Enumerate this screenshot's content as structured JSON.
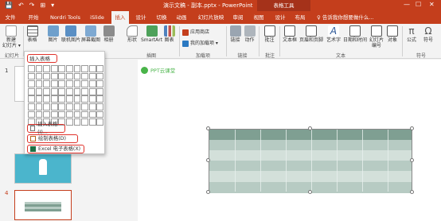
{
  "titlebar": {
    "quick_access": [
      "💾",
      "↶",
      "↷",
      "⊞",
      "▾"
    ],
    "doc_title": "演示文稿 - 副本.pptx  -  PowerPoint",
    "context_tool": "表格工具",
    "window_controls": [
      "—",
      "☐",
      "✕"
    ]
  },
  "tabs": [
    {
      "label": "文件"
    },
    {
      "label": "开始"
    },
    {
      "label": "Nordri Tools"
    },
    {
      "label": "iSlide"
    },
    {
      "label": "插入"
    },
    {
      "label": "设计"
    },
    {
      "label": "切换"
    },
    {
      "label": "动画"
    },
    {
      "label": "幻灯片放映"
    },
    {
      "label": "审阅"
    },
    {
      "label": "视图"
    },
    {
      "label": "设计"
    },
    {
      "label": "布局"
    }
  ],
  "active_tab": "插入",
  "tell_me": "♀ 告诉我你想要做什么...",
  "ribbon": {
    "buttons": {
      "new_slide": "新建\n幻灯片 ▾",
      "table": "表格",
      "picture": "图片",
      "online_picture": "联机图片",
      "screenshot": "屏幕截图",
      "album": "相册",
      "shapes": "形状",
      "smartart": "SmartArt",
      "chart": "图表",
      "link": "链接",
      "action": "动作",
      "comment": "批注",
      "textbox": "文本框",
      "header_footer": "页眉和页脚",
      "wordart": "艺术字",
      "datetime": "日期和时间",
      "slide_number": "幻灯片\n编号",
      "object": "对象",
      "formula": "公式",
      "symbol": "符号"
    },
    "store": "应用商店",
    "my_addins": "我的加载项 ▾",
    "groups": {
      "slides": "幻灯片",
      "illustrations": "插图",
      "addins": "加载项",
      "links": "链接",
      "comments": "批注",
      "text": "文本",
      "symbols": "符号"
    }
  },
  "dropdown": {
    "header": "插入表格",
    "grid_rows": 8,
    "grid_cols": 10,
    "items": [
      "插入表格(I)...",
      "绘制表格(D)",
      "Excel 电子表格(X)"
    ]
  },
  "thumbnails": [
    {
      "number": "1"
    },
    {
      "number": "4"
    }
  ],
  "watermark": "PPT云课堂",
  "colors": {
    "accent": "#c43e1c",
    "highlight": "#e0312a",
    "table_dark": "#7f9f92",
    "table_light": "#b7cbc3",
    "watermark": "#49b449"
  },
  "icons": {
    "table": "table-icon",
    "picture": "picture-icon",
    "shapes": "shapes-icon",
    "chart": "chart-icon",
    "link": "link-icon",
    "comment": "comment-icon",
    "symbol": "omega-icon"
  }
}
